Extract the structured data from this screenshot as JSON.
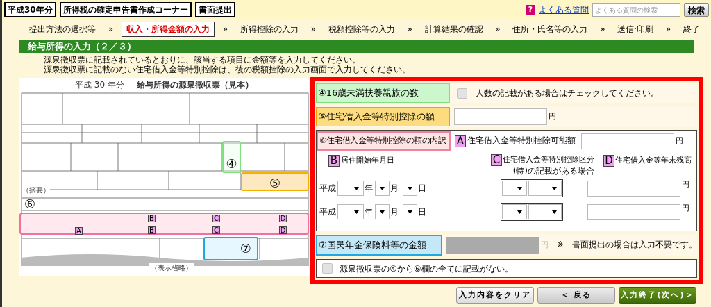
{
  "header": {
    "badges": [
      "平成30年分",
      "所得税の確定申告書作成コーナー",
      "書面提出"
    ],
    "help_icon": "?",
    "faq_link": "よくある質問",
    "search": {
      "placeholder": "よくある質問の検索"
    },
    "search_button": "検索"
  },
  "steps": [
    {
      "kind": "step",
      "label": "提出方法の選択等",
      "selected": false
    },
    {
      "kind": "separator",
      "label": "»"
    },
    {
      "kind": "step",
      "label": "収入・所得金額の入力",
      "selected": true
    },
    {
      "kind": "separator",
      "label": "»"
    },
    {
      "kind": "step",
      "label": "所得控除の入力",
      "selected": false
    },
    {
      "kind": "separator",
      "label": "»"
    },
    {
      "kind": "step",
      "label": "税額控除等の入力",
      "selected": false
    },
    {
      "kind": "separator",
      "label": "»"
    },
    {
      "kind": "step",
      "label": "計算結果の確認",
      "selected": false
    },
    {
      "kind": "separator",
      "label": "»"
    },
    {
      "kind": "step",
      "label": "住所・氏名等の入力",
      "selected": false
    },
    {
      "kind": "separator",
      "label": "»"
    },
    {
      "kind": "step",
      "label": "送信·印刷",
      "selected": false
    },
    {
      "kind": "separator",
      "label": "»"
    },
    {
      "kind": "step",
      "label": "終了",
      "selected": false
    }
  ],
  "section": {
    "title": "給与所得の入力（２／３）",
    "instructions": [
      "源泉徴収票に記載されているとおりに、該当する項目に金額等を入力してください。",
      "源泉徴収票に記載のない住宅借入金等特別控除は、後の税額控除の入力画面で入力してください。"
    ]
  },
  "sample_form": {
    "year": "平成 30 年分",
    "title": "給与所得の源泉徴収票（見本）",
    "summary_label": "（摘要）",
    "omitted_label": "（表示省略）",
    "markers": [
      {
        "kind": "circled",
        "label": "④",
        "color": "#80e080"
      },
      {
        "kind": "circled",
        "label": "⑤",
        "color": "#f5b000"
      },
      {
        "kind": "circled",
        "label": "⑥",
        "color": "#000000"
      },
      {
        "kind": "circled",
        "label": "⑦",
        "color": "#20a8e0"
      },
      {
        "kind": "letter",
        "label": "A"
      },
      {
        "kind": "letter",
        "label": "B"
      },
      {
        "kind": "letter",
        "label": "B"
      },
      {
        "kind": "letter",
        "label": "C"
      },
      {
        "kind": "letter",
        "label": "C"
      },
      {
        "kind": "letter",
        "label": "D"
      },
      {
        "kind": "letter",
        "label": "D"
      }
    ]
  },
  "panel": {
    "dependents": {
      "label": "④16歳未満扶養親族の数",
      "checkbox_label": "人数の記載がある場合はチェックしてください。",
      "checked": false
    },
    "housing_loan": {
      "label": "⑤住宅借入金等特別控除の額",
      "unit": "円"
    },
    "breakdown": {
      "label": "⑥住宅借入金等特別控除の額の内訳",
      "a": {
        "marker": "A",
        "text": "住宅借入金等特別控除可能額",
        "unit": "円"
      },
      "b": {
        "marker": "B",
        "text": "居住開始年月日"
      },
      "c": {
        "marker": "C",
        "text": "住宅借入金等特別控除区分",
        "note": "(特)の記載がある場合"
      },
      "d": {
        "marker": "D",
        "text": "住宅借入金等年末残高"
      },
      "rows": [
        {
          "era": "平成",
          "year_unit": "年",
          "month_unit": "月",
          "day_unit": "日",
          "balance_unit": "円"
        },
        {
          "era": "平成",
          "year_unit": "年",
          "month_unit": "月",
          "day_unit": "日",
          "balance_unit": "円"
        }
      ]
    },
    "pension": {
      "label": "⑦国民年金保険料等の金額",
      "unit": "円",
      "disabled": true,
      "note": "※　書面提出の場合は入力不要です。"
    },
    "none_checkbox": {
      "label": "源泉徴収票の④から⑥欄の全てに記載がない。",
      "checked": false
    }
  },
  "buttons": [
    {
      "kind": "clear",
      "label": "入力内容をクリア"
    },
    {
      "kind": "back",
      "label": "＜ 戻る"
    },
    {
      "kind": "next",
      "label": "入力終了(次へ)＞"
    }
  ]
}
